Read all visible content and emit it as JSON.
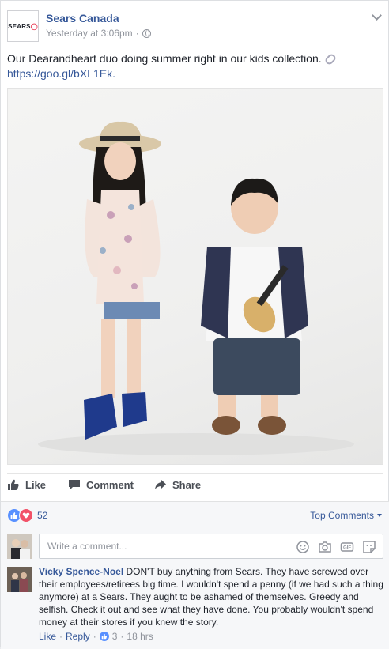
{
  "post": {
    "page_name": "Sears Canada",
    "logo_text": "SEARS",
    "timestamp": "Yesterday at 3:06pm",
    "separator": "·",
    "text": "Our Dearandheart duo doing summer right in our kids collection.",
    "link": "https://goo.gl/bXL1Ek.",
    "icons": {
      "privacy": "globe-icon",
      "options": "chevron-down-icon",
      "link_emoji": "link-icon"
    }
  },
  "actions": {
    "like": "Like",
    "comment": "Comment",
    "share": "Share"
  },
  "reactions": {
    "count": "52",
    "types": [
      "like",
      "love"
    ],
    "colors": {
      "like": "#5890ff",
      "love": "#f25268"
    },
    "sort_label": "Top Comments"
  },
  "composer": {
    "placeholder": "Write a comment...",
    "icons": [
      "emoji-icon",
      "camera-icon",
      "gif-icon",
      "sticker-icon"
    ]
  },
  "comment": {
    "author": "Vicky Spence-Noel",
    "text": "DON'T buy anything from Sears. They have screwed over their employees/retirees big time. I wouldn't spend a penny (if we had such a thing anymore) at a Sears. They aught to be ashamed of themselves. Greedy and selfish. Check it out and see what they have done. You probably wouldn't spend money at their stores if you knew the story.",
    "like_label": "Like",
    "reply_label": "Reply",
    "like_count": "3",
    "age": "18 hrs",
    "dot": "·"
  },
  "colors": {
    "link": "#365899",
    "muted": "#90949c",
    "action": "#4b4f56"
  }
}
